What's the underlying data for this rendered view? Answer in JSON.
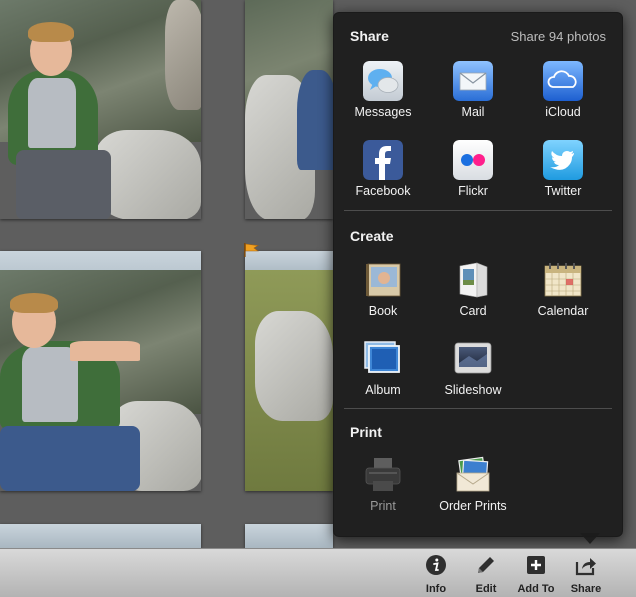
{
  "popover": {
    "share_title": "Share",
    "share_count": "Share 94 photos",
    "share_items": [
      {
        "label": "Messages",
        "icon": "messages-icon"
      },
      {
        "label": "Mail",
        "icon": "mail-icon"
      },
      {
        "label": "iCloud",
        "icon": "icloud-icon"
      },
      {
        "label": "Facebook",
        "icon": "facebook-icon"
      },
      {
        "label": "Flickr",
        "icon": "flickr-icon"
      },
      {
        "label": "Twitter",
        "icon": "twitter-icon"
      }
    ],
    "create_title": "Create",
    "create_items": [
      {
        "label": "Book",
        "icon": "book-icon"
      },
      {
        "label": "Card",
        "icon": "card-icon"
      },
      {
        "label": "Calendar",
        "icon": "calendar-icon"
      },
      {
        "label": "Album",
        "icon": "album-icon"
      },
      {
        "label": "Slideshow",
        "icon": "slideshow-icon"
      }
    ],
    "print_title": "Print",
    "print_items": [
      {
        "label": "Print",
        "icon": "printer-icon",
        "disabled": true
      },
      {
        "label": "Order Prints",
        "icon": "order-prints-icon"
      }
    ]
  },
  "toolbar": {
    "info_label": "Info",
    "edit_label": "Edit",
    "add_to_label": "Add To",
    "share_label": "Share"
  },
  "colors": {
    "popover_bg": "#1c1c1c",
    "grid_bg": "#5e5e5e",
    "toolbar_bg": "#c4c4c4",
    "flag": "#f0a020"
  }
}
